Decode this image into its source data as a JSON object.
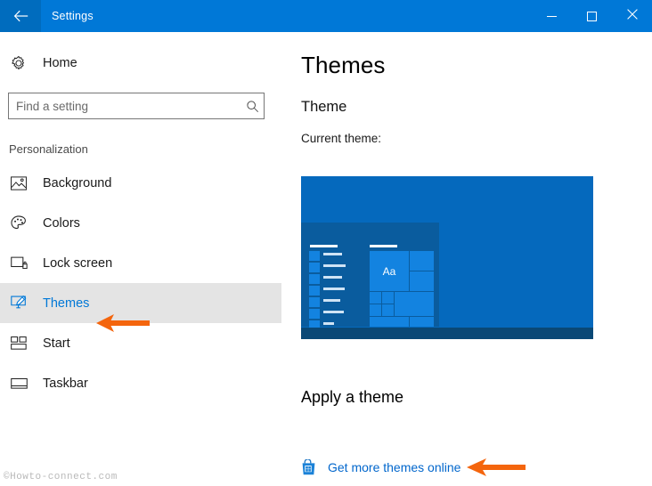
{
  "window": {
    "title": "Settings",
    "back_icon": "back-arrow-icon",
    "titlebar_color": "#0078d7",
    "controls": {
      "minimize": "minimize-icon",
      "maximize": "maximize-icon",
      "close": "close-icon"
    }
  },
  "sidebar": {
    "home": {
      "label": "Home",
      "icon": "gear-icon"
    },
    "search": {
      "placeholder": "Find a setting",
      "value": "",
      "icon": "search-icon"
    },
    "section_title": "Personalization",
    "items": [
      {
        "label": "Background",
        "icon": "picture-icon",
        "selected": false
      },
      {
        "label": "Colors",
        "icon": "palette-icon",
        "selected": false
      },
      {
        "label": "Lock screen",
        "icon": "lock-screen-icon",
        "selected": false
      },
      {
        "label": "Themes",
        "icon": "themes-icon",
        "selected": true
      },
      {
        "label": "Start",
        "icon": "start-tiles-icon",
        "selected": false
      },
      {
        "label": "Taskbar",
        "icon": "taskbar-icon",
        "selected": false
      }
    ],
    "selected_color": "#0078d7",
    "selected_row_bg": "#e4e4e4"
  },
  "main": {
    "page_title": "Themes",
    "theme_section_heading": "Theme",
    "current_theme_label": "Current theme:",
    "preview": {
      "tile_text": "Aa",
      "desktop_color": "#0569bd",
      "startmenu_color": "#0a5c9e",
      "tile_color": "#1383e0",
      "taskbar_color": "#0a4876"
    },
    "apply_heading": "Apply a theme",
    "store_link": {
      "label": "Get more themes online",
      "icon": "microsoft-store-icon",
      "color": "#0066cc"
    }
  },
  "annotations": {
    "arrow_color": "#f4650d",
    "arrows": [
      {
        "name": "arrow-pointing-to-themes",
        "points_to": "Themes"
      },
      {
        "name": "arrow-pointing-to-get-more-themes-online",
        "points_to": "Get more themes online"
      }
    ]
  },
  "watermark": {
    "text": "©Howto-connect.com"
  }
}
